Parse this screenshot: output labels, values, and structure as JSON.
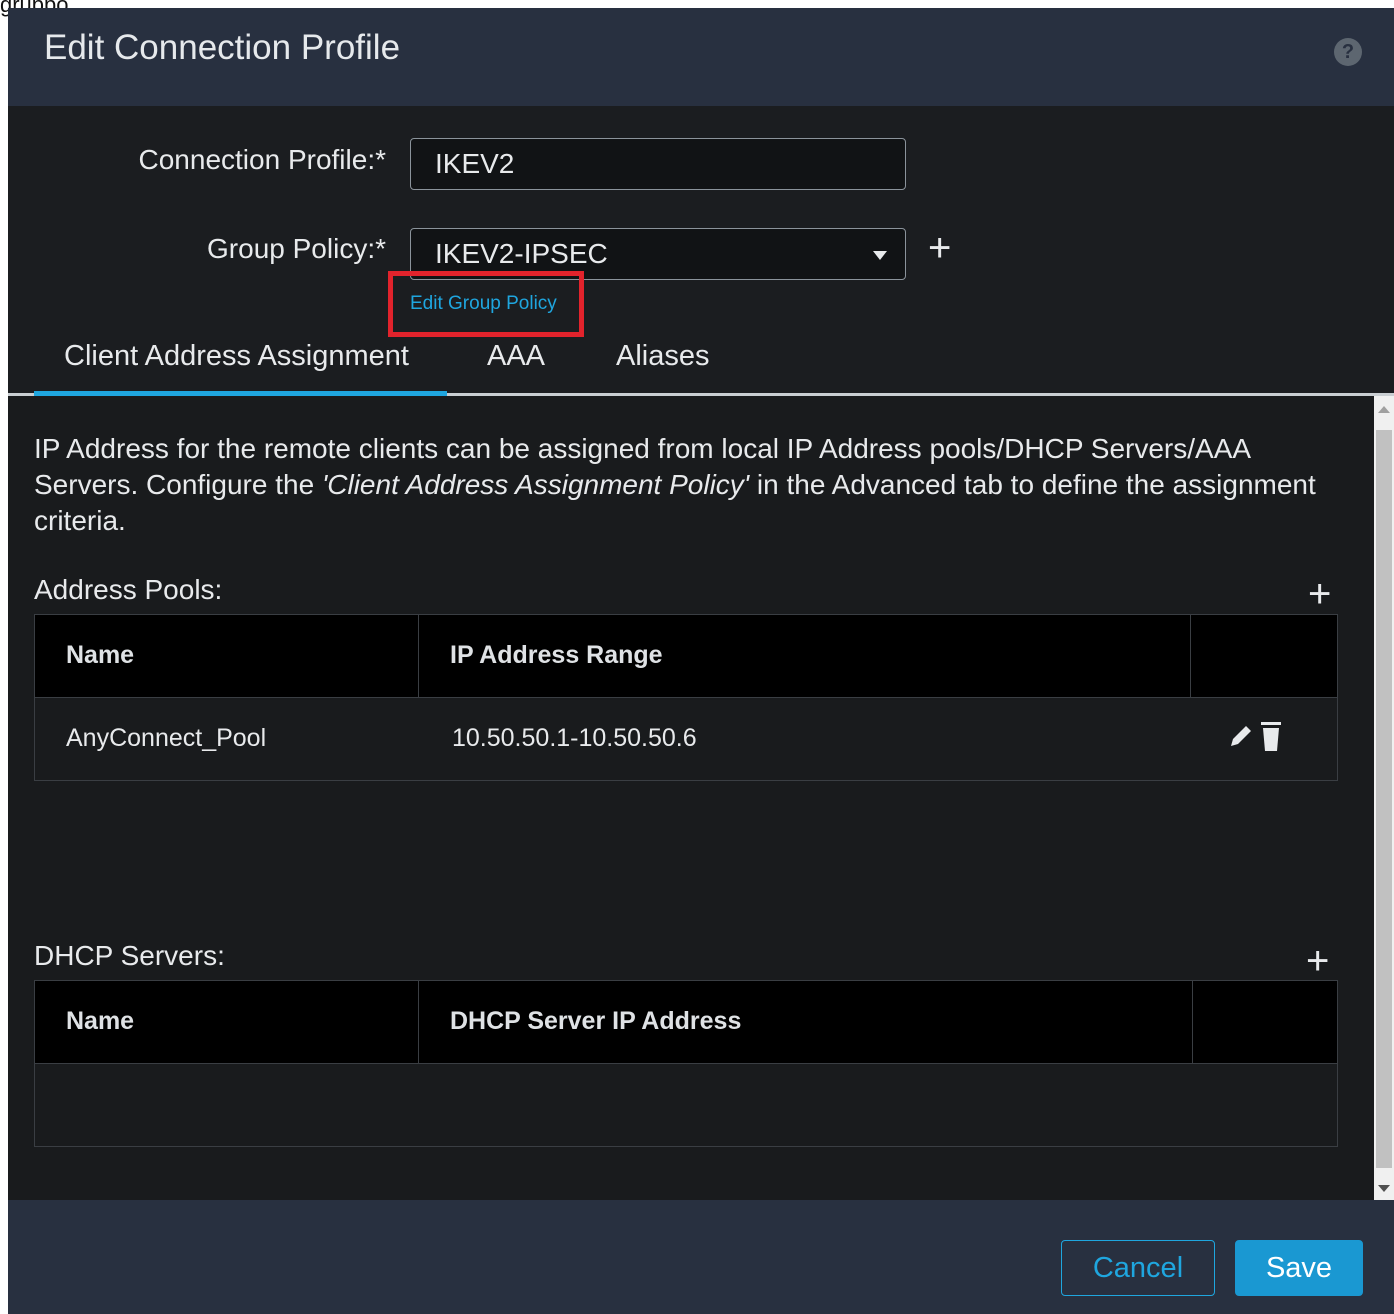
{
  "page_fragment": "gruppo.",
  "dialog": {
    "title": "Edit Connection Profile",
    "help_icon": "question-mark-icon"
  },
  "form": {
    "connection_profile_label": "Connection Profile:*",
    "connection_profile_value": "IKEV2",
    "group_policy_label": "Group Policy:*",
    "group_policy_value": "IKEV2-IPSEC",
    "edit_group_policy_link": "Edit Group Policy"
  },
  "tabs": [
    {
      "label": "Client Address Assignment",
      "active": true
    },
    {
      "label": "AAA",
      "active": false
    },
    {
      "label": "Aliases",
      "active": false
    }
  ],
  "content": {
    "description_part1": "IP Address for the remote clients can be assigned from local IP Address pools/DHCP Servers/AAA Servers. Configure the ",
    "description_emphasis": "'Client Address Assignment Policy'",
    "description_part2": " in the Advanced tab to define the assignment criteria.",
    "address_pools": {
      "label": "Address Pools:",
      "columns": [
        "Name",
        "IP Address Range",
        ""
      ],
      "rows": [
        {
          "name": "AnyConnect_Pool",
          "range": "10.50.50.1-10.50.50.6"
        }
      ]
    },
    "dhcp_servers": {
      "label": "DHCP Servers:",
      "columns": [
        "Name",
        "DHCP Server IP Address",
        ""
      ],
      "rows": []
    }
  },
  "footer": {
    "cancel_label": "Cancel",
    "save_label": "Save"
  },
  "colors": {
    "accent": "#1fa6df",
    "header_bg": "#283040",
    "body_bg": "#1b1d20",
    "highlight": "#e2232c"
  }
}
